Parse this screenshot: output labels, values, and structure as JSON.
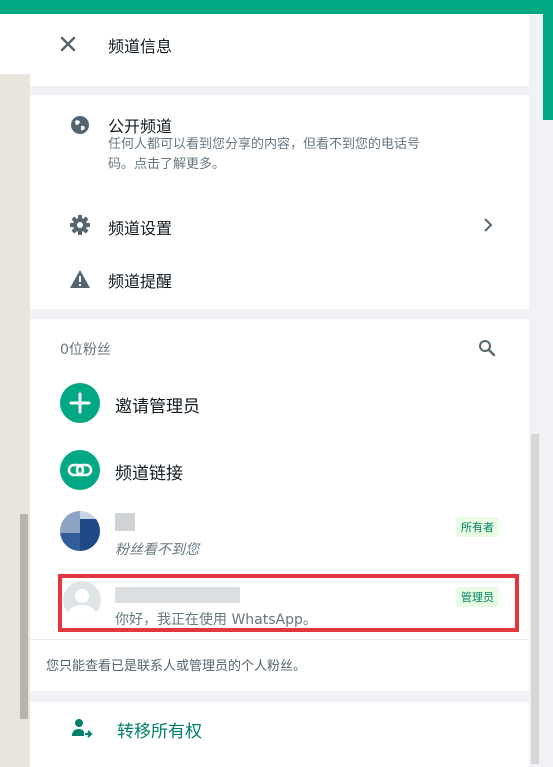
{
  "header": {
    "title": "频道信息"
  },
  "visibility": {
    "title": "公开频道",
    "description_line1": "任何人都可以看到您分享的内容，但看不到您的电话号",
    "description_line2": "码。点击了解更多。"
  },
  "settings": {
    "label": "频道设置"
  },
  "alerts": {
    "label": "频道提醒"
  },
  "followers": {
    "count_label": "0位粉丝",
    "invite_admin": "邀请管理员",
    "channel_link": "频道链接",
    "members": [
      {
        "subtitle": "粉丝看不到您",
        "badge": "所有者"
      },
      {
        "subtitle": "你好，我正在使用 WhatsApp。",
        "badge": "管理员"
      }
    ],
    "note": "您只能查看已是联系人或管理员的个人粉丝。"
  },
  "transfer": {
    "label": "转移所有权"
  },
  "colors": {
    "accent": "#00a884",
    "highlight": "#e0383e",
    "badge_bg": "#e7fce3",
    "badge_text": "#008069"
  }
}
